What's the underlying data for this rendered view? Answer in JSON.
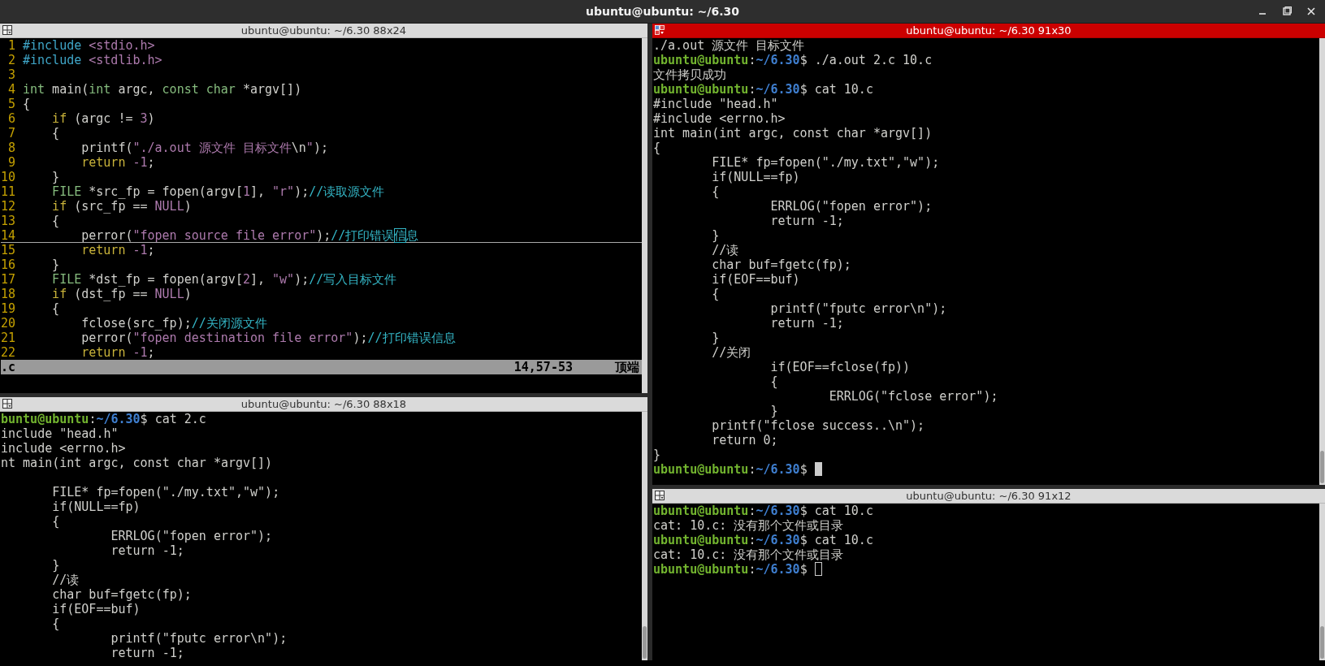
{
  "window": {
    "title": "ubuntu@ubuntu: ~/6.30"
  },
  "columns": [
    {
      "panes": [
        {
          "kind": "vim",
          "title": "ubuntu@ubuntu: ~/6.30 88x24",
          "focused": false,
          "lines": [
            {
              "number": "1",
              "segments": [
                {
                  "kind": "pre",
                  "text": "#include"
                },
                {
                  "kind": "str",
                  "text": " <stdio.h>"
                }
              ]
            },
            {
              "number": "2",
              "segments": [
                {
                  "kind": "pre",
                  "text": "#include"
                },
                {
                  "kind": "str",
                  "text": " <stdlib.h>"
                }
              ]
            },
            {
              "number": "3"
            },
            {
              "number": "4",
              "segments": [
                {
                  "kind": "type",
                  "text": "int"
                },
                {
                  "kind": "plain",
                  "text": " main("
                },
                {
                  "kind": "type",
                  "text": "int"
                },
                {
                  "kind": "plain",
                  "text": " argc, "
                },
                {
                  "kind": "type",
                  "text": "const char"
                },
                {
                  "kind": "plain",
                  "text": " *argv[])"
                }
              ]
            },
            {
              "number": "5",
              "segments": [
                {
                  "kind": "plain",
                  "text": "{"
                }
              ]
            },
            {
              "number": "6",
              "segments": [
                {
                  "kind": "kw",
                  "text": "    if"
                },
                {
                  "kind": "plain",
                  "text": " (argc != "
                },
                {
                  "kind": "num",
                  "text": "3"
                },
                {
                  "kind": "plain",
                  "text": ")"
                }
              ]
            },
            {
              "number": "7",
              "segments": [
                {
                  "kind": "plain",
                  "text": "    {"
                }
              ]
            },
            {
              "number": "8",
              "segments": [
                {
                  "kind": "plain",
                  "text": "        printf("
                },
                {
                  "kind": "str",
                  "text": "\"./a.out 源文件 目标文件"
                },
                {
                  "kind": "plain",
                  "text": "\\n"
                },
                {
                  "kind": "str",
                  "text": "\""
                },
                {
                  "kind": "plain",
                  "text": ");"
                }
              ]
            },
            {
              "number": "9",
              "segments": [
                {
                  "kind": "kw",
                  "text": "        return"
                },
                {
                  "kind": "num",
                  "text": " -1"
                },
                {
                  "kind": "plain",
                  "text": ";"
                }
              ]
            },
            {
              "number": "10",
              "segments": [
                {
                  "kind": "plain",
                  "text": "    }"
                }
              ]
            },
            {
              "number": "11",
              "segments": [
                {
                  "kind": "type",
                  "text": "    FILE"
                },
                {
                  "kind": "plain",
                  "text": " *src_fp = fopen(argv["
                },
                {
                  "kind": "num",
                  "text": "1"
                },
                {
                  "kind": "plain",
                  "text": "], "
                },
                {
                  "kind": "str",
                  "text": "\"r\""
                },
                {
                  "kind": "plain",
                  "text": ");"
                },
                {
                  "kind": "com",
                  "text": "//读取源文件"
                }
              ]
            },
            {
              "number": "12",
              "segments": [
                {
                  "kind": "kw",
                  "text": "    if"
                },
                {
                  "kind": "plain",
                  "text": " (src_fp == "
                },
                {
                  "kind": "num",
                  "text": "NULL"
                },
                {
                  "kind": "plain",
                  "text": ")"
                }
              ]
            },
            {
              "number": "13",
              "segments": [
                {
                  "kind": "plain",
                  "text": "    {"
                }
              ]
            },
            {
              "number": "14",
              "cursorline": true,
              "segments": [
                {
                  "kind": "plain",
                  "text": "        perror("
                },
                {
                  "kind": "str",
                  "text": "\"fopen source file error\""
                },
                {
                  "kind": "plain",
                  "text": ");"
                },
                {
                  "kind": "com",
                  "text": "//打印错误"
                },
                {
                  "kind": "com",
                  "text": "信",
                  "cursor": true
                },
                {
                  "kind": "com",
                  "text": "息"
                }
              ]
            },
            {
              "number": "15",
              "segments": [
                {
                  "kind": "kw",
                  "text": "        return"
                },
                {
                  "kind": "num",
                  "text": " -1"
                },
                {
                  "kind": "plain",
                  "text": ";"
                }
              ]
            },
            {
              "number": "16",
              "segments": [
                {
                  "kind": "plain",
                  "text": "    }"
                }
              ]
            },
            {
              "number": "17",
              "segments": [
                {
                  "kind": "type",
                  "text": "    FILE"
                },
                {
                  "kind": "plain",
                  "text": " *dst_fp = fopen(argv["
                },
                {
                  "kind": "num",
                  "text": "2"
                },
                {
                  "kind": "plain",
                  "text": "], "
                },
                {
                  "kind": "str",
                  "text": "\"w\""
                },
                {
                  "kind": "plain",
                  "text": ");"
                },
                {
                  "kind": "com",
                  "text": "//写入目标文件"
                }
              ]
            },
            {
              "number": "18",
              "segments": [
                {
                  "kind": "kw",
                  "text": "    if"
                },
                {
                  "kind": "plain",
                  "text": " (dst_fp == "
                },
                {
                  "kind": "num",
                  "text": "NULL"
                },
                {
                  "kind": "plain",
                  "text": ")"
                }
              ]
            },
            {
              "number": "19",
              "segments": [
                {
                  "kind": "plain",
                  "text": "    {"
                }
              ]
            },
            {
              "number": "20",
              "segments": [
                {
                  "kind": "plain",
                  "text": "        fclose(src_fp);"
                },
                {
                  "kind": "com",
                  "text": "//关闭源文件"
                }
              ]
            },
            {
              "number": "21",
              "segments": [
                {
                  "kind": "plain",
                  "text": "        perror("
                },
                {
                  "kind": "str",
                  "text": "\"fopen destination file error\""
                },
                {
                  "kind": "plain",
                  "text": ");"
                },
                {
                  "kind": "com",
                  "text": "//打印错误信息"
                }
              ]
            },
            {
              "number": "22",
              "segments": [
                {
                  "kind": "kw",
                  "text": "        return"
                },
                {
                  "kind": "num",
                  "text": " -1"
                },
                {
                  "kind": "plain",
                  "text": ";"
                }
              ]
            }
          ],
          "status": {
            "file": ".c",
            "position": "14,57-53",
            "scroll": "顶端"
          }
        },
        {
          "kind": "shell",
          "title": "ubuntu@ubuntu: ~/6.30 88x18",
          "focused": false,
          "lines": [
            {
              "segments": [
                {
                  "kind": "user",
                  "text": "buntu@ubuntu"
                },
                {
                  "kind": "plain",
                  "text": ":"
                },
                {
                  "kind": "path",
                  "text": "~/6.30"
                },
                {
                  "kind": "plain",
                  "text": "$ cat 2.c"
                }
              ]
            },
            {
              "segments": [
                {
                  "kind": "plain",
                  "text": "include \"head.h\""
                }
              ]
            },
            {
              "segments": [
                {
                  "kind": "plain",
                  "text": "include <errno.h>"
                }
              ]
            },
            {
              "segments": [
                {
                  "kind": "plain",
                  "text": "nt main(int argc, const char *argv[])"
                }
              ]
            },
            {
              "kind": "blank"
            },
            {
              "segments": [
                {
                  "kind": "plain",
                  "text": "       FILE* fp=fopen(\"./my.txt\",\"w\");"
                }
              ]
            },
            {
              "segments": [
                {
                  "kind": "plain",
                  "text": "       if(NULL==fp)"
                }
              ]
            },
            {
              "segments": [
                {
                  "kind": "plain",
                  "text": "       {"
                }
              ]
            },
            {
              "segments": [
                {
                  "kind": "plain",
                  "text": "               ERRLOG(\"fopen error\");"
                }
              ]
            },
            {
              "segments": [
                {
                  "kind": "plain",
                  "text": "               return -1;"
                }
              ]
            },
            {
              "segments": [
                {
                  "kind": "plain",
                  "text": "       }"
                }
              ]
            },
            {
              "segments": [
                {
                  "kind": "plain",
                  "text": "       //读"
                }
              ]
            },
            {
              "segments": [
                {
                  "kind": "plain",
                  "text": "       char buf=fgetc(fp);"
                }
              ]
            },
            {
              "segments": [
                {
                  "kind": "plain",
                  "text": "       if(EOF==buf)"
                }
              ]
            },
            {
              "segments": [
                {
                  "kind": "plain",
                  "text": "       {"
                }
              ]
            },
            {
              "segments": [
                {
                  "kind": "plain",
                  "text": "               printf(\"fputc error\\n\");"
                }
              ]
            },
            {
              "segments": [
                {
                  "kind": "plain",
                  "text": "               return -1;"
                }
              ]
            }
          ]
        }
      ]
    },
    {
      "panes": [
        {
          "kind": "shell",
          "title": "ubuntu@ubuntu: ~/6.30 91x30",
          "focused": true,
          "lines": [
            {
              "segments": [
                {
                  "kind": "plain",
                  "text": "./a.out 源文件 目标文件"
                }
              ]
            },
            {
              "segments": [
                {
                  "kind": "user",
                  "text": "ubuntu@ubuntu"
                },
                {
                  "kind": "plain",
                  "text": ":"
                },
                {
                  "kind": "path",
                  "text": "~/6.30"
                },
                {
                  "kind": "plain",
                  "text": "$ ./a.out 2.c 10.c"
                }
              ]
            },
            {
              "segments": [
                {
                  "kind": "plain",
                  "text": "文件拷贝成功"
                }
              ]
            },
            {
              "segments": [
                {
                  "kind": "user",
                  "text": "ubuntu@ubuntu"
                },
                {
                  "kind": "plain",
                  "text": ":"
                },
                {
                  "kind": "path",
                  "text": "~/6.30"
                },
                {
                  "kind": "plain",
                  "text": "$ cat 10.c"
                }
              ]
            },
            {
              "segments": [
                {
                  "kind": "plain",
                  "text": "#include \"head.h\""
                }
              ]
            },
            {
              "segments": [
                {
                  "kind": "plain",
                  "text": "#include <errno.h>"
                }
              ]
            },
            {
              "segments": [
                {
                  "kind": "plain",
                  "text": "int main(int argc, const char *argv[])"
                }
              ]
            },
            {
              "segments": [
                {
                  "kind": "plain",
                  "text": "{"
                }
              ]
            },
            {
              "segments": [
                {
                  "kind": "plain",
                  "text": "        FILE* fp=fopen(\"./my.txt\",\"w\");"
                }
              ]
            },
            {
              "segments": [
                {
                  "kind": "plain",
                  "text": "        if(NULL==fp)"
                }
              ]
            },
            {
              "segments": [
                {
                  "kind": "plain",
                  "text": "        {"
                }
              ]
            },
            {
              "segments": [
                {
                  "kind": "plain",
                  "text": "                ERRLOG(\"fopen error\");"
                }
              ]
            },
            {
              "segments": [
                {
                  "kind": "plain",
                  "text": "                return -1;"
                }
              ]
            },
            {
              "segments": [
                {
                  "kind": "plain",
                  "text": "        }"
                }
              ]
            },
            {
              "segments": [
                {
                  "kind": "plain",
                  "text": "        //读"
                }
              ]
            },
            {
              "segments": [
                {
                  "kind": "plain",
                  "text": "        char buf=fgetc(fp);"
                }
              ]
            },
            {
              "segments": [
                {
                  "kind": "plain",
                  "text": "        if(EOF==buf)"
                }
              ]
            },
            {
              "segments": [
                {
                  "kind": "plain",
                  "text": "        {"
                }
              ]
            },
            {
              "segments": [
                {
                  "kind": "plain",
                  "text": "                printf(\"fputc error\\n\");"
                }
              ]
            },
            {
              "segments": [
                {
                  "kind": "plain",
                  "text": "                return -1;"
                }
              ]
            },
            {
              "segments": [
                {
                  "kind": "plain",
                  "text": "        }"
                }
              ]
            },
            {
              "segments": [
                {
                  "kind": "plain",
                  "text": "        //关闭"
                }
              ]
            },
            {
              "segments": [
                {
                  "kind": "plain",
                  "text": "                if(EOF==fclose(fp))"
                }
              ]
            },
            {
              "segments": [
                {
                  "kind": "plain",
                  "text": "                {"
                }
              ]
            },
            {
              "segments": [
                {
                  "kind": "plain",
                  "text": "                        ERRLOG(\"fclose error\");"
                }
              ]
            },
            {
              "segments": [
                {
                  "kind": "plain",
                  "text": "                }"
                }
              ]
            },
            {
              "segments": [
                {
                  "kind": "plain",
                  "text": "        printf(\"fclose success..\\n\");"
                }
              ]
            },
            {
              "segments": [
                {
                  "kind": "plain",
                  "text": "        return 0;"
                }
              ]
            },
            {
              "segments": [
                {
                  "kind": "plain",
                  "text": "}"
                }
              ]
            },
            {
              "cursor": true,
              "segments": [
                {
                  "kind": "user",
                  "text": "ubuntu@ubuntu"
                },
                {
                  "kind": "plain",
                  "text": ":"
                },
                {
                  "kind": "path",
                  "text": "~/6.30"
                },
                {
                  "kind": "plain",
                  "text": "$"
                }
              ]
            }
          ]
        },
        {
          "kind": "shell",
          "title": "ubuntu@ubuntu: ~/6.30 91x12",
          "focused": false,
          "lines": [
            {
              "segments": [
                {
                  "kind": "user",
                  "text": "ubuntu@ubuntu"
                },
                {
                  "kind": "plain",
                  "text": ":"
                },
                {
                  "kind": "path",
                  "text": "~/6.30"
                },
                {
                  "kind": "plain",
                  "text": "$ cat 10.c"
                }
              ]
            },
            {
              "segments": [
                {
                  "kind": "plain",
                  "text": "cat: 10.c: 没有那个文件或目录"
                }
              ]
            },
            {
              "segments": [
                {
                  "kind": "user",
                  "text": "ubuntu@ubuntu"
                },
                {
                  "kind": "plain",
                  "text": ":"
                },
                {
                  "kind": "path",
                  "text": "~/6.30"
                },
                {
                  "kind": "plain",
                  "text": "$ cat 10.c"
                }
              ]
            },
            {
              "segments": [
                {
                  "kind": "plain",
                  "text": "cat: 10.c: 没有那个文件或目录"
                }
              ]
            },
            {
              "cursor": true,
              "segments": [
                {
                  "kind": "user",
                  "text": "ubuntu@ubuntu"
                },
                {
                  "kind": "plain",
                  "text": ":"
                },
                {
                  "kind": "path",
                  "text": "~/6.30"
                },
                {
                  "kind": "plain",
                  "text": "$"
                }
              ]
            }
          ]
        }
      ]
    }
  ]
}
